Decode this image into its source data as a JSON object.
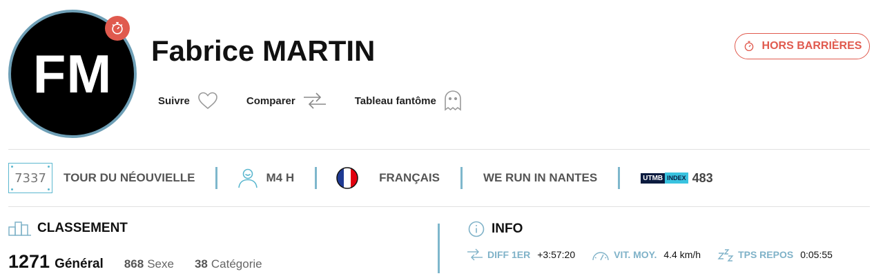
{
  "runner": {
    "initials": "FM",
    "name": "Fabrice MARTIN"
  },
  "actions": {
    "follow_label": "Suivre",
    "compare_label": "Comparer",
    "ghost_label": "Tableau fantôme"
  },
  "status_button": {
    "label": "HORS BARRIÈRES",
    "color": "#e05a4e"
  },
  "info_strip": {
    "bib": "7337",
    "race": "TOUR DU NÉOUVIELLE",
    "category": "M4 H",
    "nationality": "FRANÇAIS",
    "club": "WE RUN IN NANTES",
    "utmb_logo_text": "UTMB",
    "utmb_index_text": "INDEX",
    "utmb_index_value": "483"
  },
  "classement": {
    "title": "CLASSEMENT",
    "general_rank": "1271",
    "general_label": "Général",
    "sex_rank": "868",
    "sex_label": "Sexe",
    "category_rank": "38",
    "category_label": "Catégorie"
  },
  "info": {
    "title": "INFO",
    "diff_label": "DIFF 1ER",
    "diff_value": "+3:57:20",
    "speed_label": "VIT. MOY.",
    "speed_value": "4.4 km/h",
    "rest_label": "TPS REPOS",
    "rest_value": "0:05:55"
  },
  "colors": {
    "accent_blue": "#5bb7cf",
    "alert_red": "#e05a4e",
    "avatar_ring": "#6e9fb6"
  }
}
